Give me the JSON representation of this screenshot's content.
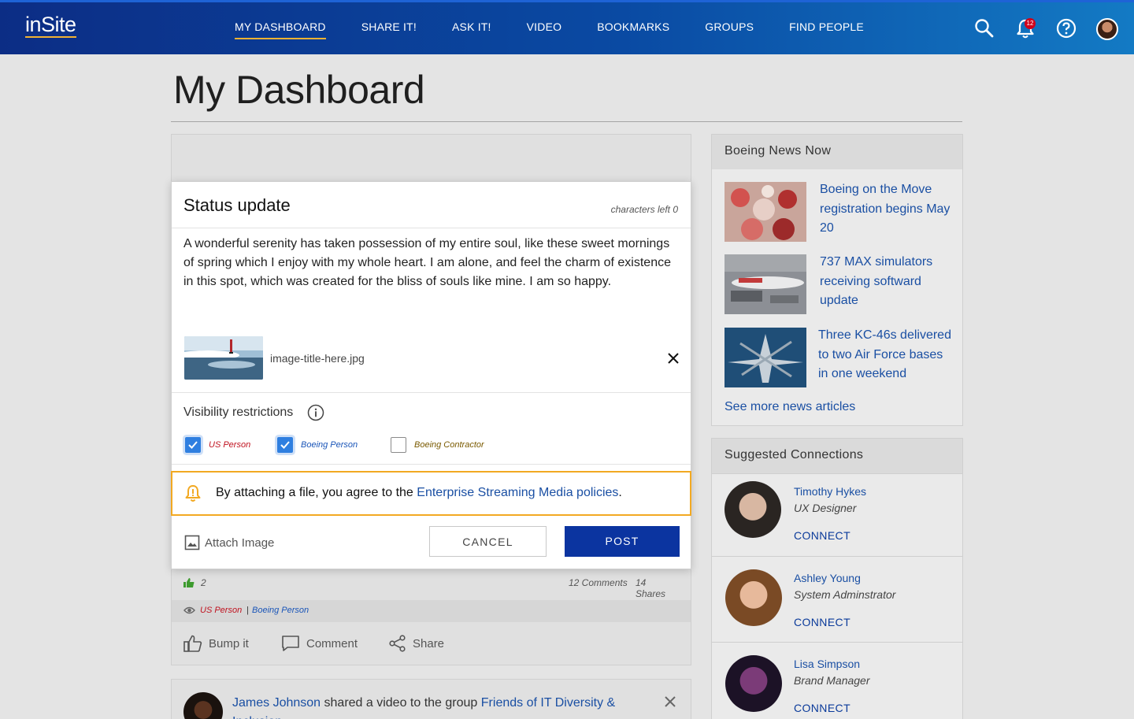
{
  "header": {
    "logo": "inSite",
    "nav": [
      "MY DASHBOARD",
      "SHARE IT!",
      "ASK IT!",
      "VIDEO",
      "BOOKMARKS",
      "GROUPS",
      "FIND PEOPLE"
    ],
    "notification_count": "12",
    "icons": [
      "search-icon",
      "bell-icon",
      "help-icon",
      "avatar"
    ]
  },
  "page": {
    "title": "My Dashboard"
  },
  "news": {
    "heading": "Boeing News Now",
    "items": [
      "Boeing on the Move registration begins May 20",
      "737 MAX simulators receiving softward update",
      "Three KC-46s delivered to two Air Force bases in one weekend"
    ],
    "see_more": "See more news articles"
  },
  "connections": {
    "heading": "Suggested Connections",
    "people": [
      {
        "name": "Timothy Hykes",
        "role": "UX Designer",
        "action": "CONNECT"
      },
      {
        "name": "Ashley Young",
        "role": "System Adminstrator",
        "action": "CONNECT"
      },
      {
        "name": "Lisa Simpson",
        "role": "Brand Manager",
        "action": "CONNECT"
      }
    ]
  },
  "modal": {
    "title": "Status update",
    "chars_left": "characters left 0",
    "body": "A wonderful serenity has taken possession of my entire soul, like these sweet mornings of spring which I enjoy with my whole heart. I am alone, and feel the charm of existence in this spot, which was created for the bliss of souls like mine. I am so happy.",
    "attachment_name": "image-title-here.jpg",
    "visibility_label": "Visibility restrictions",
    "checkboxes": [
      {
        "label": "US Person",
        "checked": true,
        "color": "#c0121f"
      },
      {
        "label": "Boeing Person",
        "checked": true,
        "color": "#1a55b8"
      },
      {
        "label": "Boeing Contractor",
        "checked": false,
        "color": "#7a5a00"
      }
    ],
    "notice_prefix": "By attaching a file, you agree to the ",
    "notice_link": "Enterprise Streaming Media policies",
    "notice_suffix": ".",
    "attach_image": "Attach Image",
    "cancel": "CANCEL",
    "post": "POST"
  },
  "feed": {
    "likes": "2",
    "comments": "12 Comments",
    "shares": "14 Shares",
    "vis_us": "US Person",
    "vis_sep": "|",
    "vis_boeing": "Boeing Person",
    "actions": [
      "Bump it",
      "Comment",
      "Share"
    ],
    "next_post_user": "James Johnson",
    "next_post_text": "shared a video to the group",
    "next_post_group": "Friends of IT Diversity & Inclusion"
  },
  "colors": {
    "accent": "#f2b233",
    "primary": "#0b34a0",
    "link": "#1a4fa3",
    "warning": "#f2a922"
  }
}
